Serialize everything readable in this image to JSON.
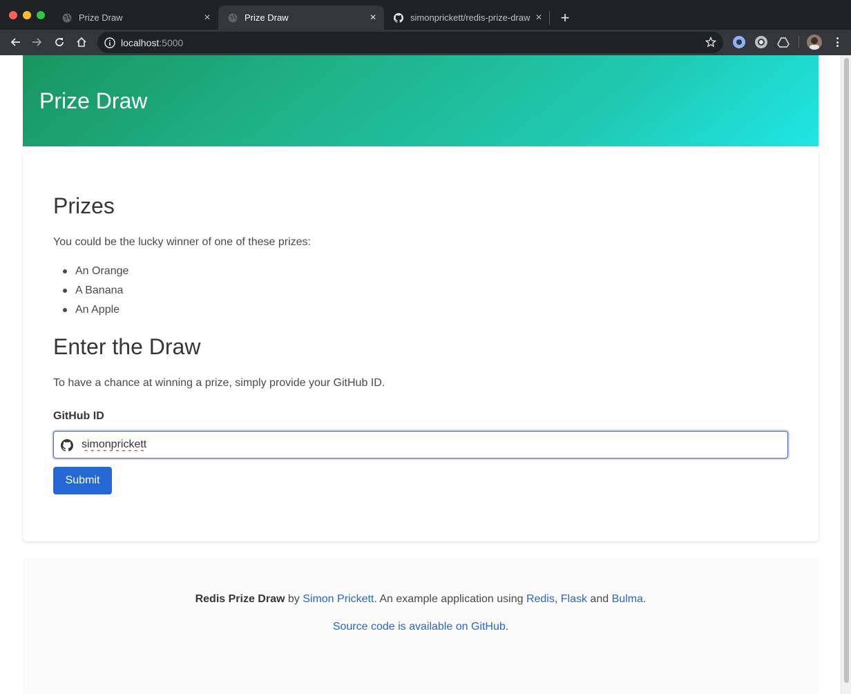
{
  "browser": {
    "tabs": [
      {
        "title": "Prize Draw",
        "active": false,
        "icon": "globe-icon"
      },
      {
        "title": "Prize Draw",
        "active": true,
        "icon": "globe-icon"
      },
      {
        "title": "simonprickett/redis-prize-draw",
        "active": false,
        "icon": "github-icon"
      }
    ],
    "close_glyph": "×",
    "new_tab_glyph": "+",
    "url_host": "localhost",
    "url_port": ":5000"
  },
  "hero": {
    "title": "Prize Draw"
  },
  "prizes": {
    "heading": "Prizes",
    "intro": "You could be the lucky winner of one of these prizes:",
    "items": [
      "An Orange",
      "A Banana",
      "An Apple"
    ]
  },
  "entry": {
    "heading": "Enter the Draw",
    "description": "To have a chance at winning a prize, simply provide your GitHub ID.",
    "label": "GitHub ID",
    "value": "simonprickett",
    "submit_label": "Submit"
  },
  "footer": {
    "app_name": "Redis Prize Draw",
    "by_text": " by ",
    "author": "Simon Prickett",
    "using_text": ". An example application using ",
    "tech_1": "Redis",
    "comma": ", ",
    "tech_2": "Flask",
    "and_text": " and ",
    "tech_3": "Bulma",
    "period": ".",
    "source_link": "Source code is available on GitHub",
    "source_period": "."
  },
  "colors": {
    "accent": "#2468d4",
    "hero_start": "#18955f",
    "hero_end": "#1fe6e6"
  }
}
